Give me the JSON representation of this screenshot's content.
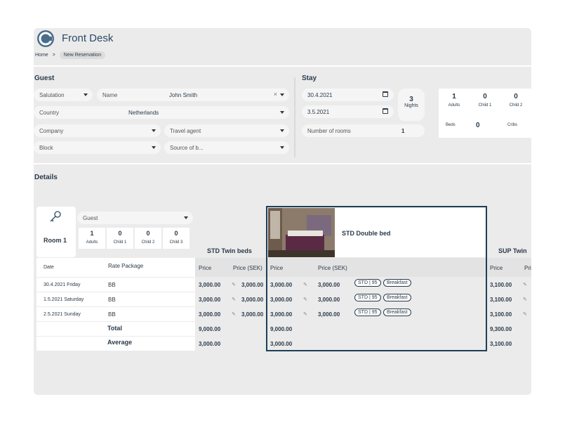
{
  "app": {
    "title": "Front Desk"
  },
  "breadcrumb": {
    "home": "Home",
    "sep": ">",
    "current": "New Reservation"
  },
  "guest": {
    "heading": "Guest",
    "salutation_placeholder": "Salutation",
    "name_label": "Name",
    "name_value": "John Smith",
    "clear": "×",
    "country_label": "Country",
    "country_value": "Netherlands",
    "company_placeholder": "Company",
    "travel_agent_placeholder": "Travel agent",
    "block_placeholder": "Block",
    "source_placeholder": "Source of b..."
  },
  "stay": {
    "heading": "Stay",
    "arrival": "30.4.2021",
    "departure": "3.5.2021",
    "nights_value": "3",
    "nights_label": "Nights",
    "rooms_label": "Number of rooms",
    "rooms_value": "1",
    "adults_value": "1",
    "adults_label": "Adults",
    "child1_value": "0",
    "child1_label": "Child 1",
    "child2_value": "0",
    "child2_label": "Child 2",
    "beds_label": "Beds",
    "beds_value": "0",
    "cribs_label": "Cribs"
  },
  "details": {
    "heading": "Details",
    "room_label": "Room 1",
    "guest_placeholder": "Guest",
    "occupancy": [
      {
        "value": "1",
        "label": "Adults"
      },
      {
        "value": "0",
        "label": "Child 1"
      },
      {
        "value": "0",
        "label": "Child 2"
      },
      {
        "value": "0",
        "label": "Child 3"
      }
    ],
    "columns": {
      "date": "Date",
      "rate_package": "Rate Package",
      "price": "Price",
      "price_sek": "Price (SEK)"
    },
    "room_types": [
      "STD Twin beds",
      "STD Double bed",
      "SUP Twin"
    ],
    "rows": [
      {
        "date": "30.4.2021 Friday",
        "package": "BB",
        "twin_price": "3,000.00",
        "twin_sek": "3,000.00",
        "dbl_price": "3,000.00",
        "dbl_sek": "3,000.00",
        "sup_price": "3,100.00"
      },
      {
        "date": "1.5.2021 Saturday",
        "package": "BB",
        "twin_price": "3,000.00",
        "twin_sek": "3,000.00",
        "dbl_price": "3,000.00",
        "dbl_sek": "3,000.00",
        "sup_price": "3,100.00"
      },
      {
        "date": "2.5.2021 Sunday",
        "package": "BB",
        "twin_price": "3,000.00",
        "twin_sek": "3,000.00",
        "dbl_price": "3,000.00",
        "dbl_sek": "3,000.00",
        "sup_price": "3,100.00"
      }
    ],
    "tag_std": "STD | 95",
    "tag_breakfast": "Breakfast",
    "total_label": "Total",
    "average_label": "Average",
    "twin_total": "9,000.00",
    "dbl_total": "9,000.00",
    "sup_total": "9,300.00",
    "twin_average": "3,000.00",
    "dbl_average": "3,000.00",
    "sup_average": "3,100.00",
    "sup_price_sek_partial": "Pri"
  },
  "colors": {
    "accent": "#1f3f57",
    "panel": "#ebebeb",
    "field": "#f5f5f5"
  },
  "icons": [
    "logo-icon",
    "chevron-down-icon",
    "calendar-icon",
    "key-icon",
    "pencil-icon",
    "close-icon"
  ]
}
